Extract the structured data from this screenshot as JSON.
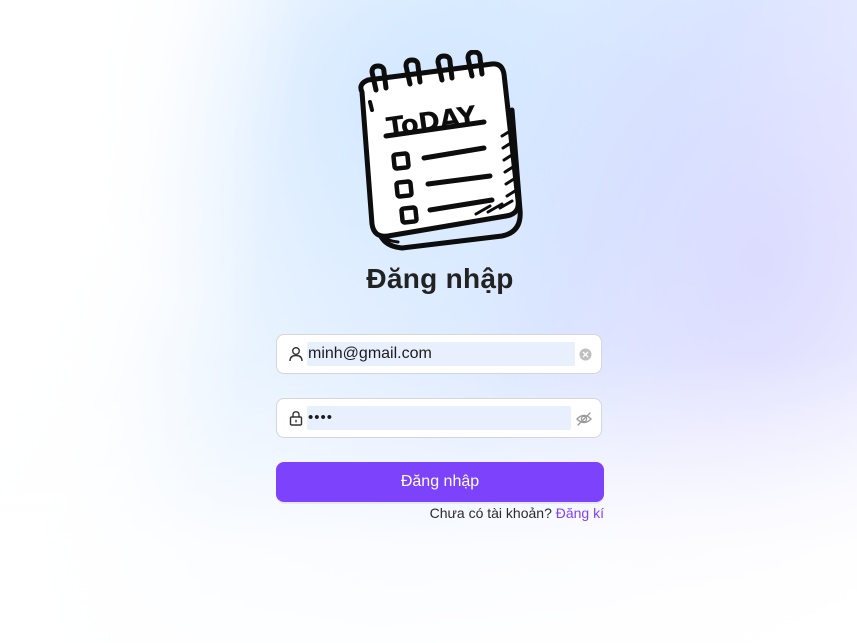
{
  "logo": {
    "text": "ToDAY",
    "icon": "notepad-checklist-icon"
  },
  "page_title": "Đăng nhập",
  "email_field": {
    "value": "minh@gmail.com",
    "lead_icon": "user-icon",
    "trail_icon": "clear-icon"
  },
  "password_field": {
    "value": "••••",
    "lead_icon": "lock-icon",
    "trail_icon": "eye-off-icon"
  },
  "submit_button": {
    "label": "Đăng nhập"
  },
  "signup_prompt": {
    "text": "Chưa có tài khoản?",
    "link": "Đăng kí"
  },
  "colors": {
    "accent": "#7d42fb",
    "autofill_bg": "#e8f0fe"
  }
}
